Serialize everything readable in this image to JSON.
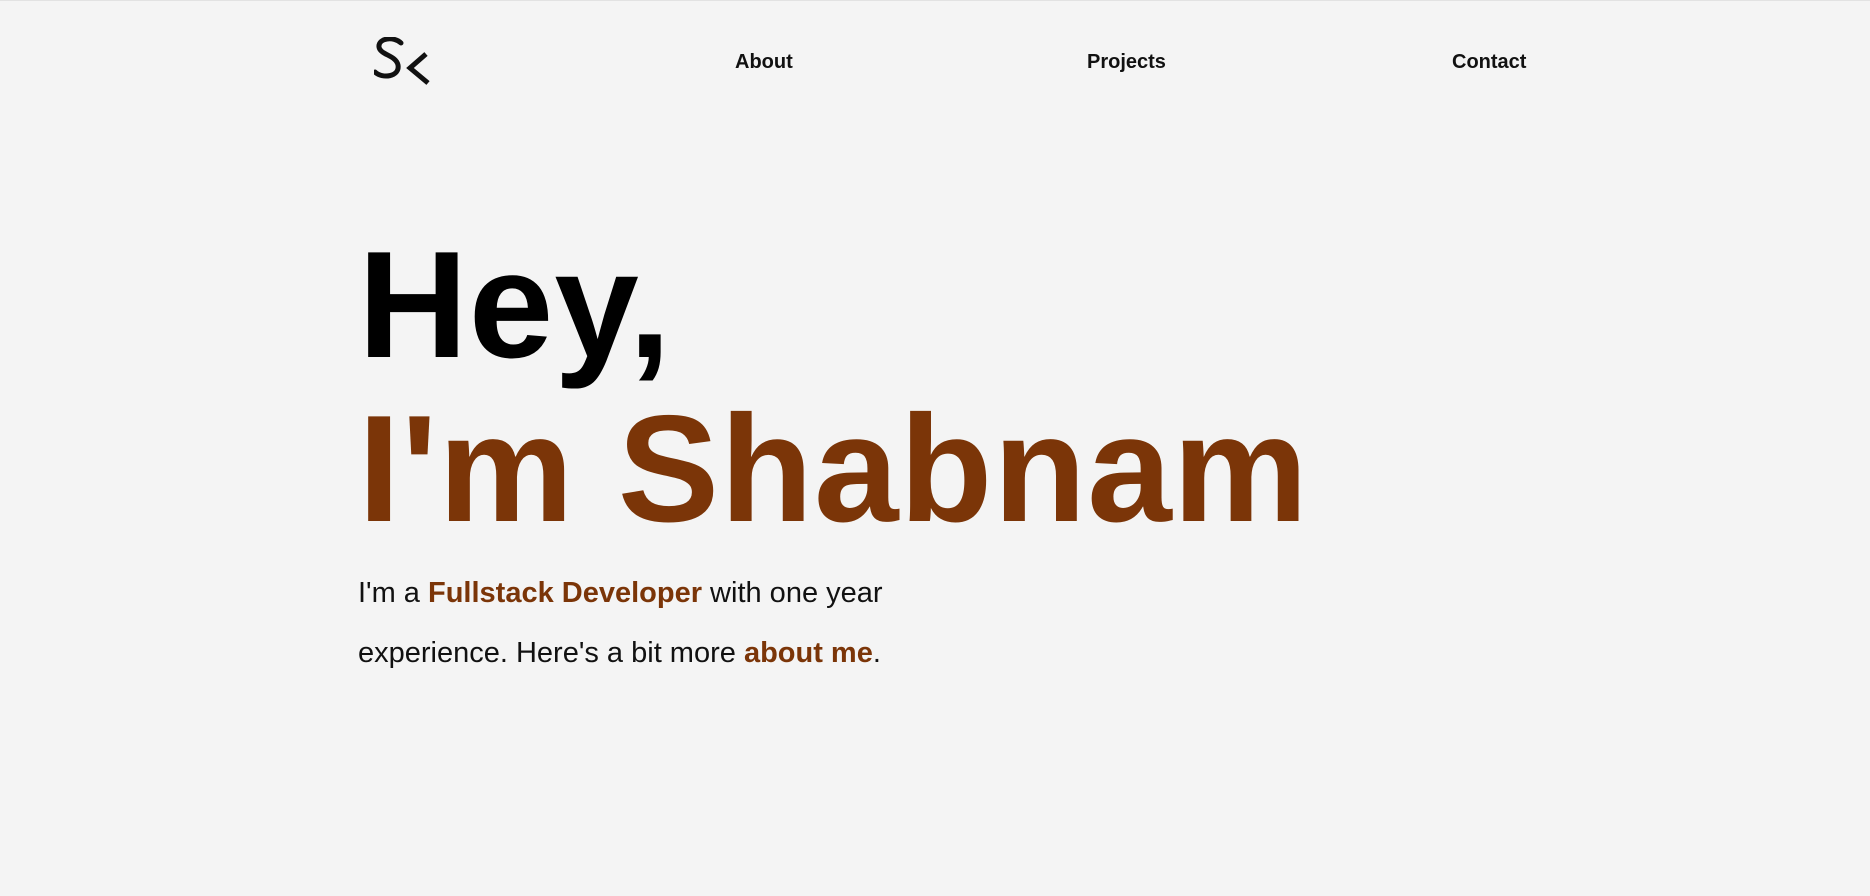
{
  "nav": {
    "logo_text": "SK",
    "links": [
      {
        "label": "About"
      },
      {
        "label": "Projects"
      },
      {
        "label": "Contact"
      }
    ]
  },
  "hero": {
    "greeting": "Hey,",
    "name_line": "I'm Shabnam"
  },
  "intro": {
    "part1": "I'm a ",
    "highlight": "Fullstack Developer",
    "part2": " with one year experience. Here's a bit more ",
    "link_label": "about me",
    "part3": "."
  },
  "colors": {
    "background": "#f4f4f4",
    "text": "#111111",
    "accent": "#7b3508"
  }
}
